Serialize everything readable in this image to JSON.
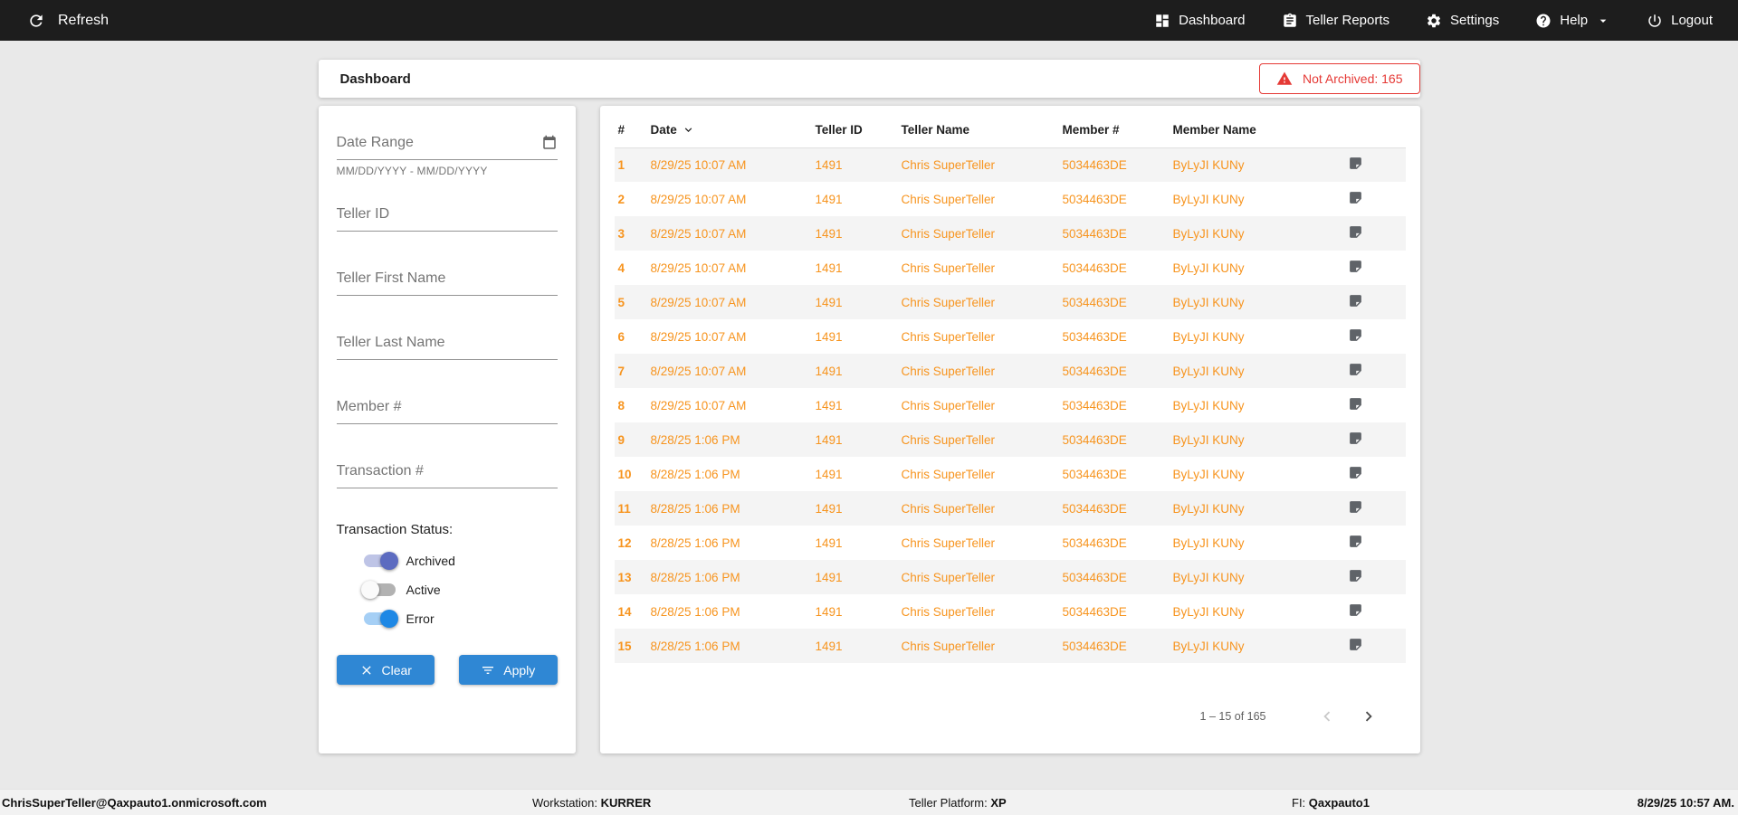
{
  "topbar": {
    "refresh_label": "Refresh",
    "items": [
      {
        "label": "Dashboard"
      },
      {
        "label": "Teller Reports"
      },
      {
        "label": "Settings"
      },
      {
        "label": "Help"
      },
      {
        "label": "Logout"
      }
    ]
  },
  "header": {
    "title": "Dashboard",
    "not_archived_badge": "Not Archived: 165"
  },
  "filters": {
    "date_range_label": "Date Range",
    "date_range_helper": "MM/DD/YYYY - MM/DD/YYYY",
    "text_fields": [
      {
        "placeholder": "Teller ID"
      },
      {
        "placeholder": "Teller First Name"
      },
      {
        "placeholder": "Teller Last Name"
      },
      {
        "placeholder": "Member #"
      },
      {
        "placeholder": "Transaction #"
      }
    ],
    "status_label": "Transaction Status:",
    "toggles": [
      {
        "label": "Archived",
        "on": true,
        "color": "#5c6bc0"
      },
      {
        "label": "Active",
        "on": false,
        "color": "#9e9e9e"
      },
      {
        "label": "Error",
        "on": true,
        "color": "#1e88e5"
      }
    ],
    "clear_label": "Clear",
    "apply_label": "Apply"
  },
  "table": {
    "columns": [
      "#",
      "Date",
      "Teller ID",
      "Teller Name",
      "Member #",
      "Member Name"
    ],
    "rows": [
      {
        "num": "1",
        "date": "8/29/25 10:07 AM",
        "teller_id": "1491",
        "teller_name": "Chris SuperTeller",
        "member_number": "5034463DE",
        "member_name": "ByLyJI KUNy"
      },
      {
        "num": "2",
        "date": "8/29/25 10:07 AM",
        "teller_id": "1491",
        "teller_name": "Chris SuperTeller",
        "member_number": "5034463DE",
        "member_name": "ByLyJI KUNy"
      },
      {
        "num": "3",
        "date": "8/29/25 10:07 AM",
        "teller_id": "1491",
        "teller_name": "Chris SuperTeller",
        "member_number": "5034463DE",
        "member_name": "ByLyJI KUNy"
      },
      {
        "num": "4",
        "date": "8/29/25 10:07 AM",
        "teller_id": "1491",
        "teller_name": "Chris SuperTeller",
        "member_number": "5034463DE",
        "member_name": "ByLyJI KUNy"
      },
      {
        "num": "5",
        "date": "8/29/25 10:07 AM",
        "teller_id": "1491",
        "teller_name": "Chris SuperTeller",
        "member_number": "5034463DE",
        "member_name": "ByLyJI KUNy"
      },
      {
        "num": "6",
        "date": "8/29/25 10:07 AM",
        "teller_id": "1491",
        "teller_name": "Chris SuperTeller",
        "member_number": "5034463DE",
        "member_name": "ByLyJI KUNy"
      },
      {
        "num": "7",
        "date": "8/29/25 10:07 AM",
        "teller_id": "1491",
        "teller_name": "Chris SuperTeller",
        "member_number": "5034463DE",
        "member_name": "ByLyJI KUNy"
      },
      {
        "num": "8",
        "date": "8/29/25 10:07 AM",
        "teller_id": "1491",
        "teller_name": "Chris SuperTeller",
        "member_number": "5034463DE",
        "member_name": "ByLyJI KUNy"
      },
      {
        "num": "9",
        "date": "8/28/25 1:06 PM",
        "teller_id": "1491",
        "teller_name": "Chris SuperTeller",
        "member_number": "5034463DE",
        "member_name": "ByLyJI KUNy"
      },
      {
        "num": "10",
        "date": "8/28/25 1:06 PM",
        "teller_id": "1491",
        "teller_name": "Chris SuperTeller",
        "member_number": "5034463DE",
        "member_name": "ByLyJI KUNy"
      },
      {
        "num": "11",
        "date": "8/28/25 1:06 PM",
        "teller_id": "1491",
        "teller_name": "Chris SuperTeller",
        "member_number": "5034463DE",
        "member_name": "ByLyJI KUNy"
      },
      {
        "num": "12",
        "date": "8/28/25 1:06 PM",
        "teller_id": "1491",
        "teller_name": "Chris SuperTeller",
        "member_number": "5034463DE",
        "member_name": "ByLyJI KUNy"
      },
      {
        "num": "13",
        "date": "8/28/25 1:06 PM",
        "teller_id": "1491",
        "teller_name": "Chris SuperTeller",
        "member_number": "5034463DE",
        "member_name": "ByLyJI KUNy"
      },
      {
        "num": "14",
        "date": "8/28/25 1:06 PM",
        "teller_id": "1491",
        "teller_name": "Chris SuperTeller",
        "member_number": "5034463DE",
        "member_name": "ByLyJI KUNy"
      },
      {
        "num": "15",
        "date": "8/28/25 1:06 PM",
        "teller_id": "1491",
        "teller_name": "Chris SuperTeller",
        "member_number": "5034463DE",
        "member_name": "ByLyJI KUNy"
      }
    ],
    "pagination": {
      "range_label": "1 – 15 of 165"
    }
  },
  "footer": {
    "user_email": "ChrisSuperTeller@Qaxpauto1.onmicrosoft.com",
    "workstation_label": "Workstation:",
    "workstation_value": "KURRER",
    "platform_label": "Teller Platform:",
    "platform_value": "XP",
    "fi_label": "FI:",
    "fi_value": "Qaxpauto1",
    "datetime": "8/29/25 10:57 AM."
  },
  "colors": {
    "accent_orange": "#f7941e",
    "button_blue": "#2f87d4",
    "badge_red": "#e53935"
  }
}
